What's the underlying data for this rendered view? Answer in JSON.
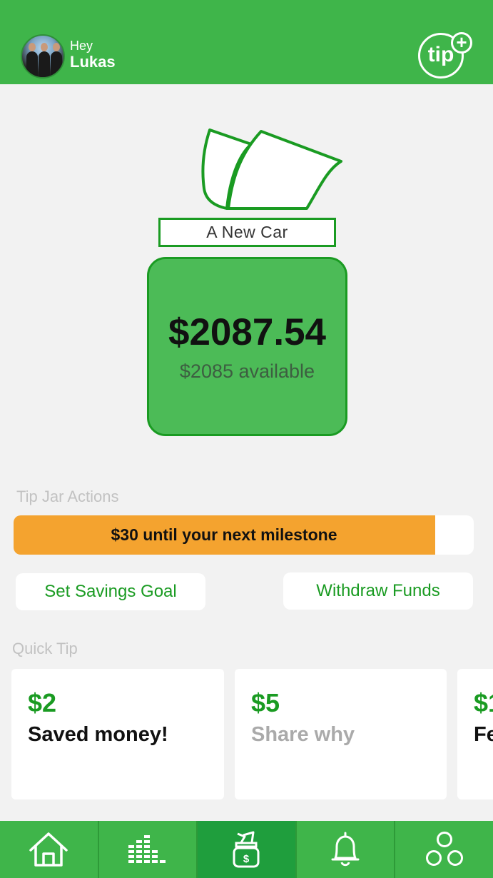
{
  "header": {
    "greeting": "Hey",
    "user_name": "Lukas",
    "tip_button_label": "tip",
    "tip_plus": "+"
  },
  "jar": {
    "goal_name": "A New Car",
    "balance": "$2087.54",
    "available": "$2085 available"
  },
  "actions": {
    "section_label": "Tip Jar Actions",
    "milestone_text": "$30 until your next milestone",
    "milestone_progress": 0.917,
    "set_goal_label": "Set Savings Goal",
    "withdraw_label": "Withdraw Funds"
  },
  "quick_tip": {
    "section_label": "Quick Tip",
    "cards": [
      {
        "amount": "$2",
        "message": "Saved money!"
      },
      {
        "amount": "$5",
        "message": "Share why"
      },
      {
        "amount": "$1",
        "message": "Fe"
      }
    ]
  },
  "tabs": [
    {
      "icon": "home-icon",
      "active": false
    },
    {
      "icon": "stats-icon",
      "active": false
    },
    {
      "icon": "tip-jar-icon",
      "active": true
    },
    {
      "icon": "bell-icon",
      "active": false
    },
    {
      "icon": "circles-icon",
      "active": false
    }
  ],
  "colors": {
    "brand_green": "#3fb54a",
    "dark_green": "#1a9b22",
    "milestone_orange": "#f4a32f",
    "background": "#f2f2f2"
  }
}
